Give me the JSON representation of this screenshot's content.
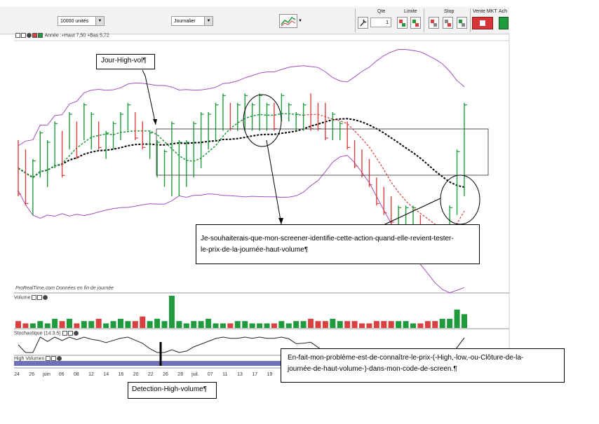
{
  "toolbar": {
    "quantity_value": "10000 unités",
    "period_value": "Journalier",
    "qte_label": "Qte",
    "qte_value": "1",
    "limite_label": "Limite",
    "stop_label": "Stop",
    "vente_label": "Vente MKT",
    "achat_label": "Ach"
  },
  "price_panel": {
    "header": "Année :+Haut 7,50 +Bas 5,72",
    "source": "ProRealTime.com  Données en fin de journée"
  },
  "volume_panel": {
    "label": "Volume"
  },
  "stoch_panel": {
    "label": "Stochastique (14.3.5)"
  },
  "hv_panel": {
    "label": "High Volumes"
  },
  "x_axis": {
    "ticks": [
      "24",
      "26",
      "juin",
      "06",
      "08",
      "12",
      "14",
      "16",
      "20",
      "22",
      "26",
      "28",
      "juil.",
      "07",
      "11",
      "13",
      "17",
      "19"
    ]
  },
  "annotations": {
    "jour_high_vol": "Jour-High-vol¶",
    "screener_line1": "Je-souhaiterais-que-mon-screener-identifie-cette-action-quand-elle-revient-tester-",
    "screener_line2": "le-prix-de-la-journée-haut-volume¶",
    "probleme_line1": "En-fait-mon-problème-est-de-connaître-le-prix-(-High,-low,-ou-Clôture-de-la-",
    "probleme_line2": "journée-de-haut-volume-)-dans-mon-code-de-screen.¶",
    "detection": "Detection-High-volume¶"
  },
  "colors": {
    "up": "#1f9a3c",
    "down": "#d94040",
    "band": "#a050c0",
    "ma": "#000000",
    "ma_green": "#1f9a3c",
    "ma_red": "#d94040"
  },
  "chart_data": {
    "type": "bar",
    "title": "",
    "categories": [
      "24",
      "26",
      "juin",
      "06",
      "08",
      "12",
      "14",
      "16",
      "20",
      "22",
      "26",
      "28",
      "juil.",
      "07",
      "11",
      "13",
      "17",
      "19"
    ],
    "ohlc": [
      {
        "h": 7.0,
        "l": 6.4,
        "up": false
      },
      {
        "h": 6.9,
        "l": 6.3,
        "up": false
      },
      {
        "h": 6.8,
        "l": 6.2,
        "up": true
      },
      {
        "h": 7.1,
        "l": 6.6,
        "up": true
      },
      {
        "h": 7.0,
        "l": 6.5,
        "up": true
      },
      {
        "h": 7.2,
        "l": 6.7,
        "up": true
      },
      {
        "h": 7.1,
        "l": 6.6,
        "up": false
      },
      {
        "h": 7.3,
        "l": 6.9,
        "up": true
      },
      {
        "h": 7.2,
        "l": 6.8,
        "up": false
      },
      {
        "h": 7.4,
        "l": 7.0,
        "up": true
      },
      {
        "h": 7.3,
        "l": 6.9,
        "up": true
      },
      {
        "h": 7.2,
        "l": 6.9,
        "up": false
      },
      {
        "h": 7.1,
        "l": 6.8,
        "up": true
      },
      {
        "h": 7.2,
        "l": 6.9,
        "up": true
      },
      {
        "h": 7.3,
        "l": 7.0,
        "up": true
      },
      {
        "h": 7.4,
        "l": 7.1,
        "up": true
      },
      {
        "h": 7.3,
        "l": 7.0,
        "up": false
      },
      {
        "h": 7.2,
        "l": 6.9,
        "up": false
      },
      {
        "h": 7.1,
        "l": 6.8,
        "up": true
      },
      {
        "h": 7.0,
        "l": 6.6,
        "up": true
      },
      {
        "h": 6.9,
        "l": 6.5,
        "up": true
      },
      {
        "h": 7.2,
        "l": 6.4,
        "up": true
      },
      {
        "h": 7.0,
        "l": 6.4,
        "up": true
      },
      {
        "h": 7.0,
        "l": 6.5,
        "up": true
      },
      {
        "h": 7.2,
        "l": 6.6,
        "up": true
      },
      {
        "h": 7.3,
        "l": 6.7,
        "up": true
      },
      {
        "h": 7.3,
        "l": 6.9,
        "up": true
      },
      {
        "h": 7.4,
        "l": 7.0,
        "up": true
      },
      {
        "h": 7.5,
        "l": 7.1,
        "up": true
      },
      {
        "h": 7.4,
        "l": 7.1,
        "up": false
      },
      {
        "h": 7.4,
        "l": 7.1,
        "up": true
      },
      {
        "h": 7.5,
        "l": 7.1,
        "up": true
      },
      {
        "h": 7.4,
        "l": 7.1,
        "up": true
      },
      {
        "h": 7.5,
        "l": 7.1,
        "up": true
      },
      {
        "h": 7.4,
        "l": 7.1,
        "up": true
      },
      {
        "h": 7.4,
        "l": 7.1,
        "up": false
      },
      {
        "h": 7.5,
        "l": 7.2,
        "up": true
      },
      {
        "h": 7.4,
        "l": 7.2,
        "up": true
      },
      {
        "h": 7.3,
        "l": 7.1,
        "up": true
      },
      {
        "h": 7.4,
        "l": 7.1,
        "up": true
      },
      {
        "h": 7.5,
        "l": 7.1,
        "up": false
      },
      {
        "h": 7.4,
        "l": 7.1,
        "up": false
      },
      {
        "h": 7.4,
        "l": 7.0,
        "up": false
      },
      {
        "h": 7.3,
        "l": 7.0,
        "up": true
      },
      {
        "h": 7.2,
        "l": 7.0,
        "up": true
      },
      {
        "h": 7.2,
        "l": 6.9,
        "up": false
      },
      {
        "h": 7.0,
        "l": 6.7,
        "up": false
      },
      {
        "h": 6.9,
        "l": 6.6,
        "up": false
      },
      {
        "h": 6.8,
        "l": 6.5,
        "up": false
      },
      {
        "h": 6.6,
        "l": 6.3,
        "up": false
      },
      {
        "h": 6.5,
        "l": 6.2,
        "up": false
      },
      {
        "h": 6.4,
        "l": 6.1,
        "up": false
      },
      {
        "h": 6.3,
        "l": 6.1,
        "up": true
      },
      {
        "h": 6.3,
        "l": 6.1,
        "up": true
      },
      {
        "h": 6.3,
        "l": 6.1,
        "up": true
      },
      {
        "h": 6.2,
        "l": 6.0,
        "up": false
      },
      {
        "h": 6.1,
        "l": 5.9,
        "up": false
      },
      {
        "h": 6.0,
        "l": 5.8,
        "up": false
      },
      {
        "h": 6.1,
        "l": 5.9,
        "up": true
      },
      {
        "h": 6.3,
        "l": 5.9,
        "up": true
      },
      {
        "h": 6.9,
        "l": 6.2,
        "up": true
      },
      {
        "h": 7.4,
        "l": 6.4,
        "up": true
      }
    ],
    "volume": [
      3,
      2,
      2,
      3,
      2,
      4,
      3,
      4,
      2,
      3,
      3,
      4,
      2,
      3,
      4,
      3,
      3,
      5,
      3,
      4,
      3,
      14,
      3,
      2,
      3,
      3,
      4,
      2,
      2,
      2,
      3,
      3,
      2,
      2,
      2,
      2,
      3,
      2,
      3,
      3,
      4,
      3,
      3,
      4,
      3,
      3,
      3,
      2,
      2,
      3,
      3,
      3,
      3,
      3,
      2,
      2,
      3,
      3,
      4,
      4,
      8,
      6
    ]
  }
}
